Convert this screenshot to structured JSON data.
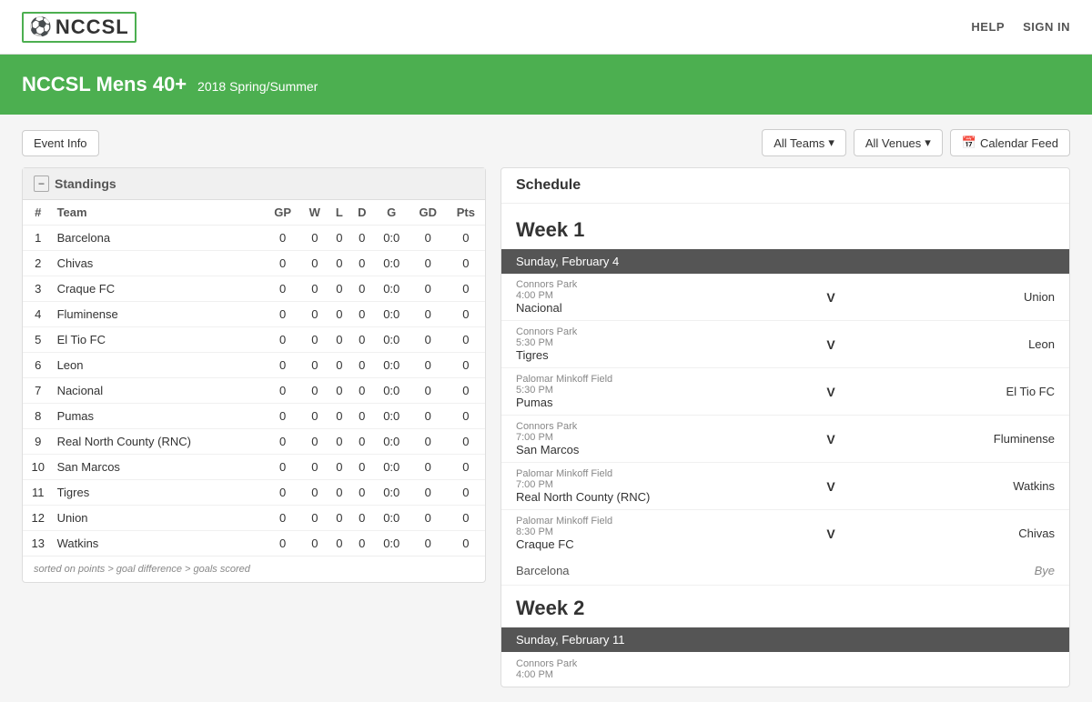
{
  "nav": {
    "logo_text": "NCCSL",
    "help_label": "HELP",
    "signin_label": "SIGN IN"
  },
  "banner": {
    "title": "NCCSL Mens 40+",
    "subtitle": "2018 Spring/Summer"
  },
  "toolbar": {
    "event_info_label": "Event Info",
    "all_teams_label": "All Teams",
    "all_venues_label": "All Venues",
    "calendar_feed_label": "Calendar Feed"
  },
  "standings": {
    "panel_label": "Standings",
    "columns": [
      "#",
      "Team",
      "GP",
      "W",
      "L",
      "D",
      "G",
      "GD",
      "Pts"
    ],
    "rows": [
      {
        "rank": 1,
        "team": "Barcelona",
        "gp": 0,
        "w": 0,
        "l": 0,
        "d": 0,
        "g": "0:0",
        "gd": 0,
        "pts": 0
      },
      {
        "rank": 2,
        "team": "Chivas",
        "gp": 0,
        "w": 0,
        "l": 0,
        "d": 0,
        "g": "0:0",
        "gd": 0,
        "pts": 0
      },
      {
        "rank": 3,
        "team": "Craque FC",
        "gp": 0,
        "w": 0,
        "l": 0,
        "d": 0,
        "g": "0:0",
        "gd": 0,
        "pts": 0
      },
      {
        "rank": 4,
        "team": "Fluminense",
        "gp": 0,
        "w": 0,
        "l": 0,
        "d": 0,
        "g": "0:0",
        "gd": 0,
        "pts": 0
      },
      {
        "rank": 5,
        "team": "El Tio FC",
        "gp": 0,
        "w": 0,
        "l": 0,
        "d": 0,
        "g": "0:0",
        "gd": 0,
        "pts": 0
      },
      {
        "rank": 6,
        "team": "Leon",
        "gp": 0,
        "w": 0,
        "l": 0,
        "d": 0,
        "g": "0:0",
        "gd": 0,
        "pts": 0
      },
      {
        "rank": 7,
        "team": "Nacional",
        "gp": 0,
        "w": 0,
        "l": 0,
        "d": 0,
        "g": "0:0",
        "gd": 0,
        "pts": 0
      },
      {
        "rank": 8,
        "team": "Pumas",
        "gp": 0,
        "w": 0,
        "l": 0,
        "d": 0,
        "g": "0:0",
        "gd": 0,
        "pts": 0
      },
      {
        "rank": 9,
        "team": "Real North County (RNC)",
        "gp": 0,
        "w": 0,
        "l": 0,
        "d": 0,
        "g": "0:0",
        "gd": 0,
        "pts": 0
      },
      {
        "rank": 10,
        "team": "San Marcos",
        "gp": 0,
        "w": 0,
        "l": 0,
        "d": 0,
        "g": "0:0",
        "gd": 0,
        "pts": 0
      },
      {
        "rank": 11,
        "team": "Tigres",
        "gp": 0,
        "w": 0,
        "l": 0,
        "d": 0,
        "g": "0:0",
        "gd": 0,
        "pts": 0
      },
      {
        "rank": 12,
        "team": "Union",
        "gp": 0,
        "w": 0,
        "l": 0,
        "d": 0,
        "g": "0:0",
        "gd": 0,
        "pts": 0
      },
      {
        "rank": 13,
        "team": "Watkins",
        "gp": 0,
        "w": 0,
        "l": 0,
        "d": 0,
        "g": "0:0",
        "gd": 0,
        "pts": 0
      }
    ],
    "sorted_note": "sorted on points > goal difference > goals scored"
  },
  "schedule": {
    "panel_label": "Schedule",
    "week1_label": "Week 1",
    "week2_label": "Week 2",
    "day1_label": "Sunday, February 4",
    "day2_label": "Sunday, February 11",
    "games": [
      {
        "venue": "Connors Park",
        "time": "4:00 PM",
        "home": "Nacional",
        "vs": "V",
        "away": "Union"
      },
      {
        "venue": "Connors Park",
        "time": "5:30 PM",
        "home": "Tigres",
        "vs": "V",
        "away": "Leon"
      },
      {
        "venue": "Palomar Minkoff Field",
        "time": "5:30 PM",
        "home": "Pumas",
        "vs": "V",
        "away": "El Tio FC"
      },
      {
        "venue": "Connors Park",
        "time": "7:00 PM",
        "home": "San Marcos",
        "vs": "V",
        "away": "Fluminense"
      },
      {
        "venue": "Palomar Minkoff Field",
        "time": "7:00 PM",
        "home": "Real North County (RNC)",
        "vs": "V",
        "away": "Watkins"
      },
      {
        "venue": "Palomar Minkoff Field",
        "time": "8:30 PM",
        "home": "Craque FC",
        "vs": "V",
        "away": "Chivas"
      }
    ],
    "bye_team": "Barcelona",
    "bye_label": "Bye",
    "week2_game_venue": "Connors Park",
    "week2_game_time": "4:00 PM"
  }
}
